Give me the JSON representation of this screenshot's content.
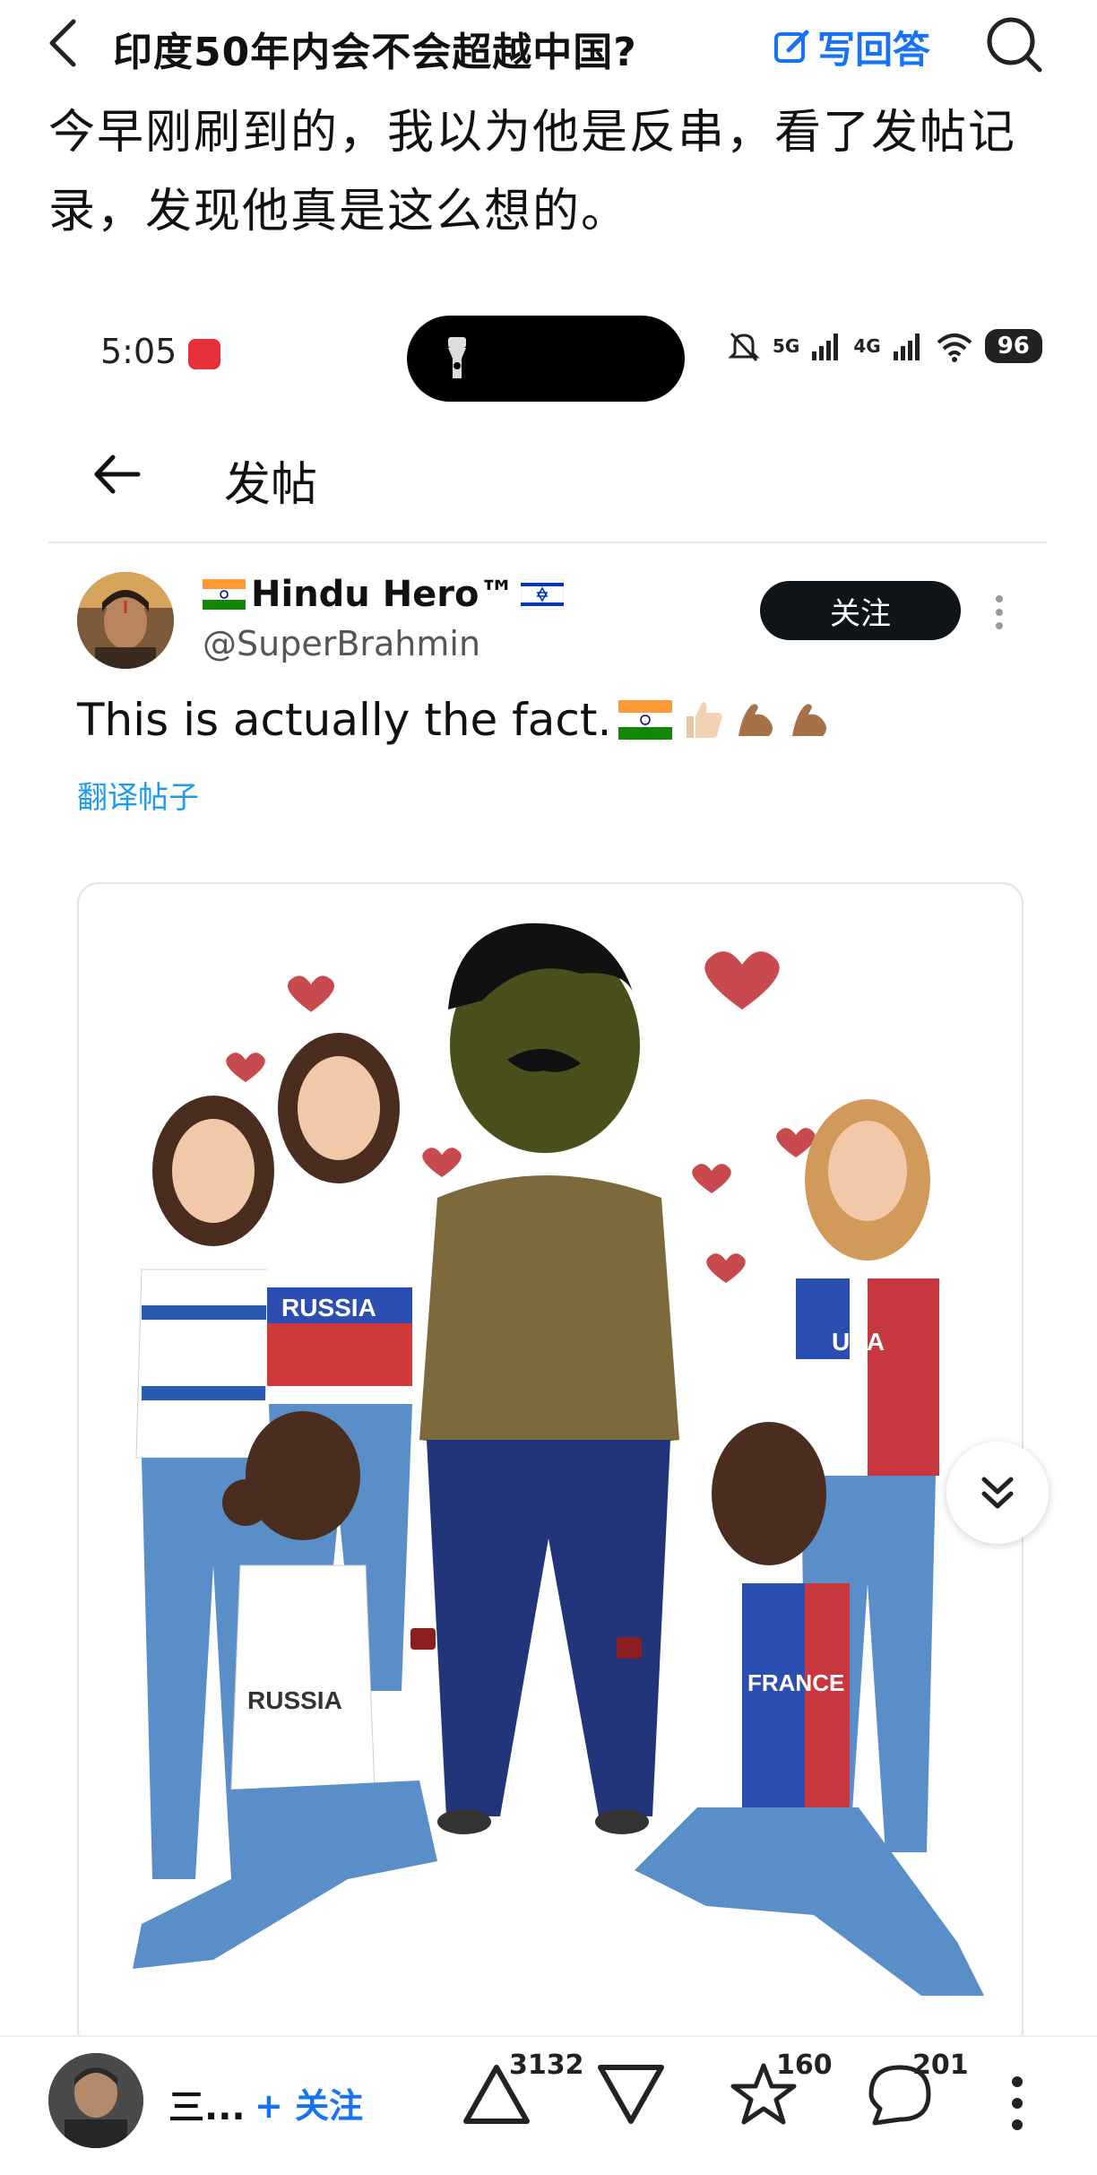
{
  "topbar": {
    "question_title": "印度50年内会不会超越中国?",
    "write_answer_label": "写回答"
  },
  "answer": {
    "text": "今早刚刷到的，我以为他是反串，看了发帖记录，发现他真是这么想的。"
  },
  "embedded_status_bar": {
    "time": "5:05",
    "battery": "96",
    "network_labels": [
      "5G",
      "4G"
    ]
  },
  "post_page": {
    "title": "发帖"
  },
  "post": {
    "author_name": "Hindu Hero™",
    "author_handle": "@SuperBrahmin",
    "follow_label": "关注",
    "text": "This is actually the fact.",
    "translate_label": "翻译帖子"
  },
  "illustration": {
    "shirt_labels": [
      "RUSSIA",
      "USA",
      "RUSSIA",
      "FRANCE"
    ]
  },
  "bottom_bar": {
    "author_name": "三...",
    "follow_label": "+ 关注",
    "upvote_count": "3132",
    "favorite_count": "160",
    "comment_count": "201"
  },
  "colors": {
    "accent_blue": "#1772f6",
    "link_blue": "#1d9bf0",
    "follow_button_bg": "#0f1419",
    "recording_red": "#e6313b"
  },
  "icons": [
    "back-icon",
    "edit-icon",
    "search-icon",
    "flashlight-icon",
    "mute-icon",
    "signal-icon",
    "wifi-icon",
    "arrow-left-icon",
    "more-vert-icon",
    "double-chevron-down-icon",
    "upvote-icon",
    "downvote-icon",
    "star-icon",
    "comment-icon",
    "more-icon"
  ]
}
